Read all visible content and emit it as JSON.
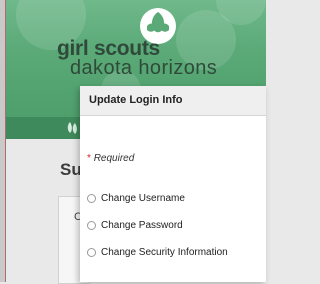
{
  "brand": {
    "line1": "girl scouts",
    "line2": "dakota horizons"
  },
  "background": {
    "heading_fragment": "Su",
    "card_fragment": "C"
  },
  "dialog": {
    "title": "Update Login Info",
    "required_marker": "*",
    "required_label": "Required",
    "options": [
      {
        "label": "Change Username",
        "selected": false
      },
      {
        "label": "Change Password",
        "selected": false
      },
      {
        "label": "Change Security Information",
        "selected": false
      }
    ]
  },
  "colors": {
    "header_green": "#5aa977",
    "subnav_green": "#3f8a5c",
    "required_red": "#d2232a"
  },
  "icons": [
    "trefoil-logo-icon",
    "trefoil-small-icon"
  ]
}
